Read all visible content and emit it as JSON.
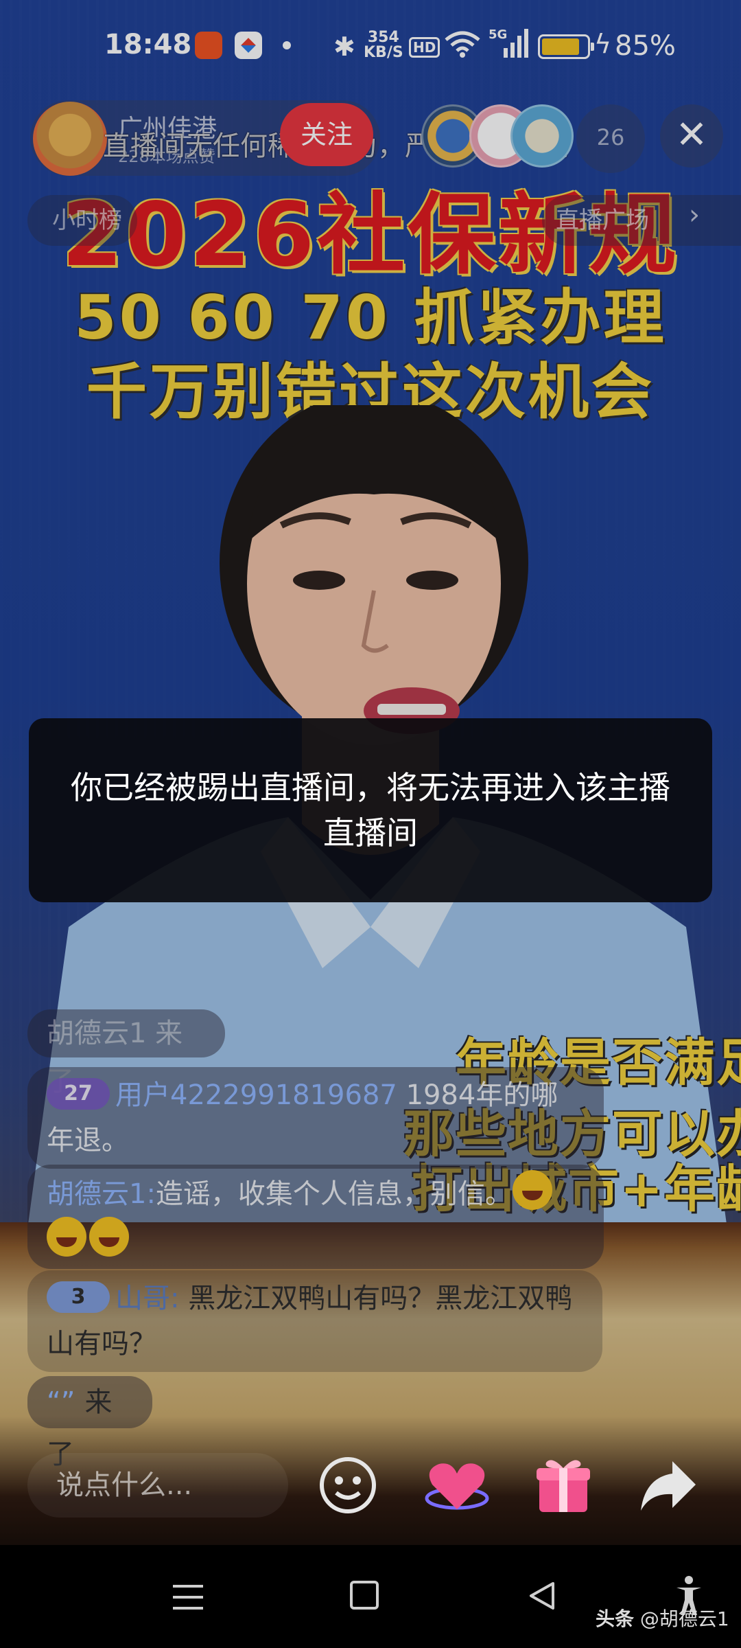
{
  "status_bar": {
    "time": "18:48",
    "net_speed_value": "354",
    "net_speed_unit": "KB/S",
    "hd_label": "HD",
    "network_label": "5G",
    "battery_percent": "85%",
    "battery_level": 0.85
  },
  "video": {
    "headline": "2026社保新规",
    "subline1": "50 60 70 抓紧办理",
    "subline2": "千万别错过这次机会",
    "side_caption1": "年龄是否满足",
    "side_caption2": "那些地方可以办",
    "side_caption3": "打出城市+年龄"
  },
  "live_header": {
    "host_name": "广州佳港",
    "host_likes": "228本场点赞",
    "notice": "直播间无任何稀缺行为，严禁宣传倾向",
    "follow_label": "关注",
    "viewer_count": "26",
    "close_label": "✕",
    "rank_label": "小时榜",
    "plaza_label": "直播广场"
  },
  "toast": {
    "message": "你已经被踢出直播间，将无法再进入该主播直播间"
  },
  "chat": {
    "join_notice": "胡德云1 来了",
    "messages": [
      {
        "level": "27",
        "user": "用户4222991819687",
        "text": "1984年的哪年退。"
      },
      {
        "level": "",
        "user": "胡德云1:",
        "text": "造谣，收集个人信息，别信。"
      },
      {
        "level": "3",
        "user": "山哥:",
        "text": "黑龙江双鸭山有吗？黑龙江双鸭山有吗？"
      }
    ],
    "last_join_quote": "“”",
    "last_join_text": "来了"
  },
  "input_bar": {
    "placeholder": "说点什么..."
  },
  "icons": {
    "emoji": "smiley-icon",
    "heart": "heart-icon",
    "gift": "gift-icon",
    "share": "share-icon"
  },
  "watermark": {
    "brand": "头条",
    "handle": "@胡德云1"
  },
  "colors": {
    "follow": "#e8323c",
    "headline_red": "#e0161b",
    "caption_yellow": "#f3d23a",
    "battery": "#f1c01e",
    "username_blue": "#8fb6ff"
  }
}
